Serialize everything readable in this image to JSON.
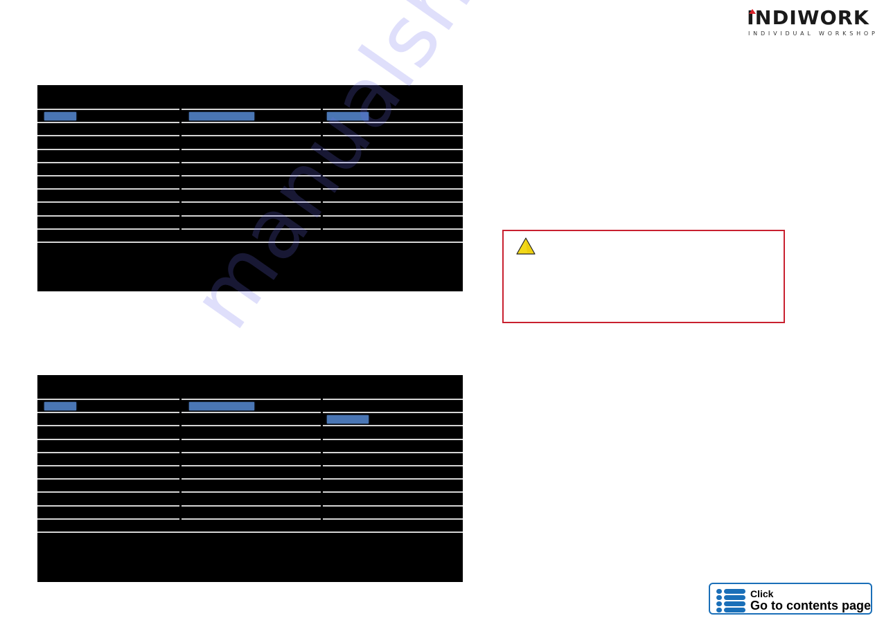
{
  "logo": {
    "brand": "INDIWORK",
    "tagline": "INDIVIDUAL WORKSHOP",
    "accent_color": "#d8232a"
  },
  "tables": [
    {
      "id": "table-1",
      "header": "",
      "rows": [
        {
          "cells": [
            "",
            "",
            ""
          ],
          "highlights": [
            0,
            1,
            2
          ]
        },
        {
          "cells": [
            "",
            "",
            ""
          ],
          "highlights": []
        },
        {
          "cells": [
            "",
            "",
            ""
          ],
          "highlights": []
        },
        {
          "cells": [
            "",
            "",
            ""
          ],
          "highlights": []
        },
        {
          "cells": [
            "",
            "",
            ""
          ],
          "highlights": []
        },
        {
          "cells": [
            "",
            "",
            ""
          ],
          "highlights": []
        },
        {
          "cells": [
            "",
            "",
            ""
          ],
          "highlights": []
        },
        {
          "cells": [
            "",
            "",
            ""
          ],
          "highlights": []
        },
        {
          "cells": [
            "",
            "",
            ""
          ],
          "highlights": []
        },
        {
          "cells": [
            "",
            "",
            ""
          ],
          "highlights": []
        }
      ],
      "footer": ""
    },
    {
      "id": "table-2",
      "header": "",
      "rows": [
        {
          "cells": [
            "",
            "",
            ""
          ],
          "highlights": [
            0,
            1
          ]
        },
        {
          "cells": [
            "",
            "",
            ""
          ],
          "highlights": [
            2
          ]
        },
        {
          "cells": [
            "",
            "",
            ""
          ],
          "highlights": []
        },
        {
          "cells": [
            "",
            "",
            ""
          ],
          "highlights": []
        },
        {
          "cells": [
            "",
            "",
            ""
          ],
          "highlights": []
        },
        {
          "cells": [
            "",
            "",
            ""
          ],
          "highlights": []
        },
        {
          "cells": [
            "",
            "",
            ""
          ],
          "highlights": []
        },
        {
          "cells": [
            "",
            "",
            ""
          ],
          "highlights": []
        },
        {
          "cells": [
            "",
            "",
            ""
          ],
          "highlights": []
        },
        {
          "cells": [
            "",
            "",
            ""
          ],
          "highlights": []
        }
      ],
      "footer": ""
    }
  ],
  "colors": {
    "table_background": "#000000",
    "row_divider": "#d6d6d6",
    "highlight": "#4a76b4",
    "warning_border": "#c8202f",
    "warning_icon_fill": "#f2d81a",
    "button_accent": "#1a6fb8"
  },
  "warning": {
    "icon": "warning-triangle-icon",
    "text": ""
  },
  "contents_button": {
    "icon": "list-icon",
    "line1": "Click",
    "line2": "Go to contents page"
  },
  "watermark": "manualshive.com"
}
